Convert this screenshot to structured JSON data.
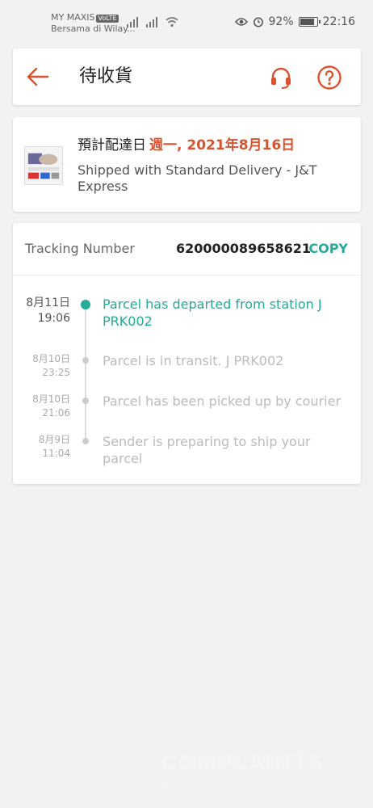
{
  "status_bar": {
    "carrier": "MY MAXIS",
    "volte": "VoLTE",
    "carrier_sub": "Bersama di Wilay...",
    "battery": "92%",
    "time": "22:16"
  },
  "header": {
    "title": "待收貨",
    "back_icon": "arrow-left-icon",
    "support_icon": "headset-icon",
    "help_icon": "question-circle-icon",
    "accent_color": "#d9532f"
  },
  "delivery": {
    "estimated_label": "預計配達日",
    "estimated_date": "週一, 2021年8月16日",
    "shipping_info": "Shipped with Standard Delivery  - J&T Express"
  },
  "tracking": {
    "label": "Tracking Number",
    "number": "620000089658621",
    "copy_label": "COPY",
    "accent_color": "#26aa99",
    "events": [
      {
        "date": "8月11日",
        "time": "19:06",
        "text": "Parcel has departed from station J PRK002",
        "active": true
      },
      {
        "date": "8月10日",
        "time": "23:25",
        "text": "Parcel is in transit. J PRK002",
        "active": false
      },
      {
        "date": "8月10日",
        "time": "21:06",
        "text": "Parcel has been picked up by courier",
        "active": false
      },
      {
        "date": "8月9日",
        "time": "11:04",
        "text": "Sender is preparing to ship your parcel",
        "active": false
      }
    ]
  },
  "watermark": {
    "line1": "COMPLAINTS",
    "line2": "BOARD"
  }
}
